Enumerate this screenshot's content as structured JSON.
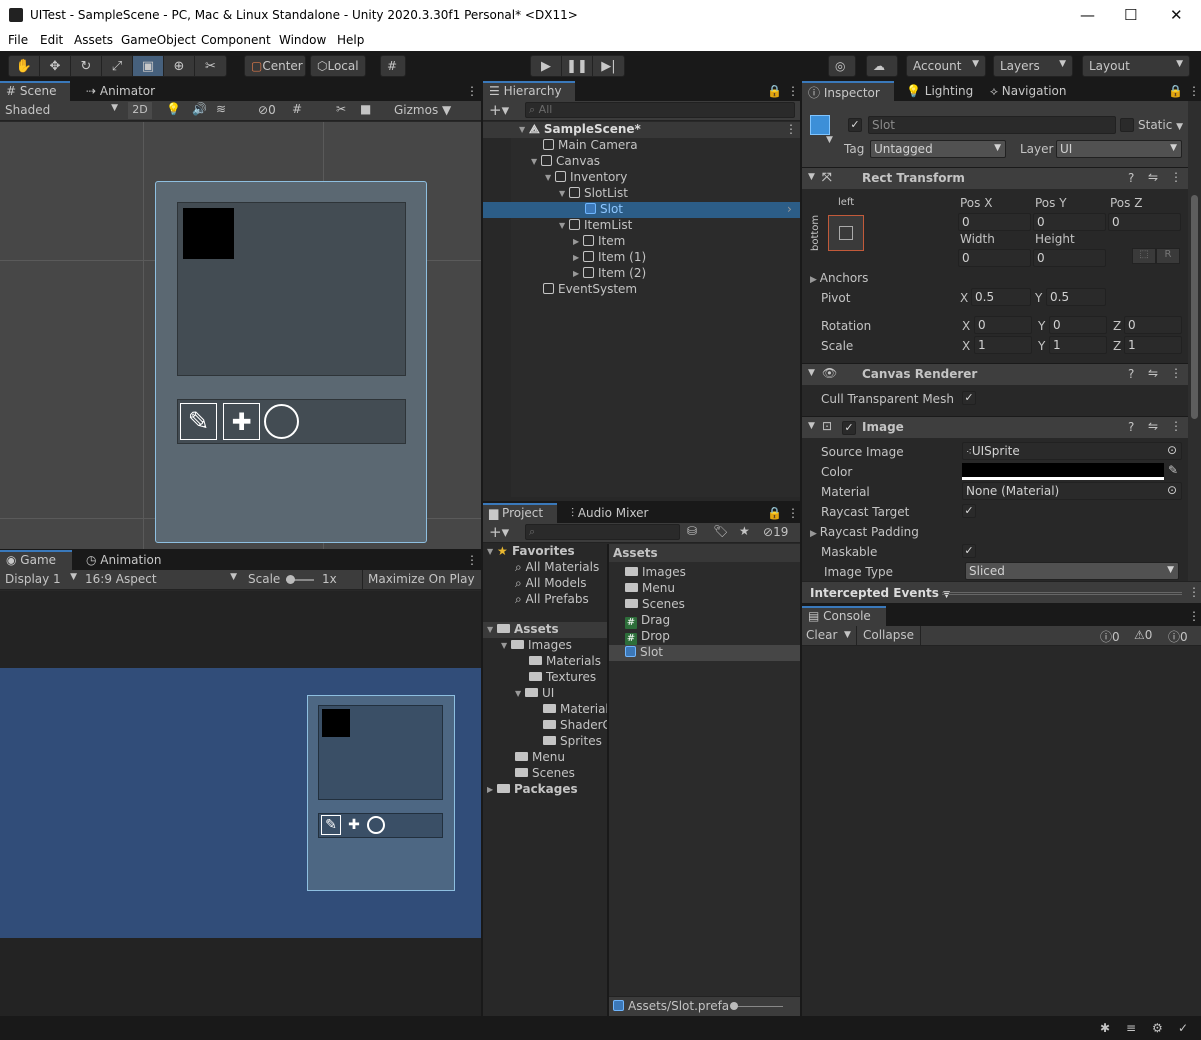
{
  "window": {
    "title": "UITest - SampleScene - PC, Mac & Linux Standalone - Unity 2020.3.30f1 Personal* <DX11>",
    "minimize": "—",
    "maximize": "☐",
    "close": "✕"
  },
  "menu": [
    "File",
    "Edit",
    "Assets",
    "GameObject",
    "Component",
    "Window",
    "Help"
  ],
  "toolbar": {
    "pivot": "Center",
    "space": "Local",
    "account": "Account",
    "layers": "Layers",
    "layout": "Layout"
  },
  "scene": {
    "tab_scene": "Scene",
    "tab_animator": "Animator",
    "shading": "Shaded",
    "mode_2d": "2D",
    "hidden_count": "0",
    "gizmos": "Gizmos"
  },
  "game": {
    "tab_game": "Game",
    "tab_animation": "Animation",
    "display": "Display 1",
    "aspect": "16:9 Aspect",
    "scale_label": "Scale",
    "scale_value": "1x",
    "maximize": "Maximize On Play"
  },
  "hierarchy": {
    "tab": "Hierarchy",
    "search_placeholder": "All",
    "items": [
      {
        "label": "SampleScene*",
        "depth": 0
      },
      {
        "label": "Main Camera",
        "depth": 1
      },
      {
        "label": "Canvas",
        "depth": 1
      },
      {
        "label": "Inventory",
        "depth": 2
      },
      {
        "label": "SlotList",
        "depth": 3
      },
      {
        "label": "Slot",
        "depth": 4
      },
      {
        "label": "ItemList",
        "depth": 3
      },
      {
        "label": "Item",
        "depth": 4
      },
      {
        "label": "Item (1)",
        "depth": 4
      },
      {
        "label": "Item (2)",
        "depth": 4
      },
      {
        "label": "EventSystem",
        "depth": 1
      }
    ]
  },
  "project": {
    "tab_project": "Project",
    "tab_mixer": "Audio Mixer",
    "hidden_count": "19",
    "favorites_label": "Favorites",
    "favorites": [
      "All Materials",
      "All Models",
      "All Prefabs"
    ],
    "assets_label": "Assets",
    "tree": [
      "Images",
      "Materials",
      "Textures",
      "UI",
      "Materials",
      "ShaderG",
      "Sprites",
      "Menu",
      "Scenes"
    ],
    "packages_label": "Packages",
    "content_header": "Assets",
    "content": [
      {
        "label": "Images",
        "type": "folder"
      },
      {
        "label": "Menu",
        "type": "folder"
      },
      {
        "label": "Scenes",
        "type": "folder"
      },
      {
        "label": "Drag",
        "type": "script"
      },
      {
        "label": "Drop",
        "type": "script"
      },
      {
        "label": "Slot",
        "type": "prefab"
      }
    ],
    "footer": "Assets/Slot.prefal"
  },
  "inspector": {
    "tab_inspector": "Inspector",
    "tab_lighting": "Lighting",
    "tab_navigation": "Navigation",
    "object_name": "Slot",
    "static_label": "Static",
    "tag_label": "Tag",
    "tag_value": "Untagged",
    "layer_label": "Layer",
    "layer_value": "UI",
    "rect": {
      "title": "Rect Transform",
      "anchor_h": "left",
      "anchor_v": "bottom",
      "posx_l": "Pos X",
      "posy_l": "Pos Y",
      "posz_l": "Pos Z",
      "posx": "0",
      "posy": "0",
      "posz": "0",
      "width_l": "Width",
      "height_l": "Height",
      "width": "0",
      "height": "0",
      "r": "R",
      "anchors": "Anchors",
      "pivot": "Pivot",
      "pivot_x": "0.5",
      "pivot_y": "0.5",
      "rotation": "Rotation",
      "rot_x": "0",
      "rot_y": "0",
      "rot_z": "0",
      "scale": "Scale",
      "scale_x": "1",
      "scale_y": "1",
      "scale_z": "1",
      "x": "X",
      "y": "Y",
      "z": "Z"
    },
    "renderer": {
      "title": "Canvas Renderer",
      "cull": "Cull Transparent Mesh"
    },
    "image": {
      "title": "Image",
      "source_l": "Source Image",
      "source": "UISprite",
      "color_l": "Color",
      "material_l": "Material",
      "material": "None (Material)",
      "raycast_t": "Raycast Target",
      "raycast_p": "Raycast Padding",
      "maskable": "Maskable",
      "type_l": "Image Type",
      "type": "Sliced"
    },
    "events": "Intercepted Events"
  },
  "console": {
    "tab": "Console",
    "clear": "Clear",
    "collapse": "Collapse",
    "info": "0",
    "warn": "0",
    "err": "0"
  },
  "colors": {
    "accent": "#3a79bb",
    "game_bg": "#314d79",
    "selection": "#2c5d87"
  }
}
